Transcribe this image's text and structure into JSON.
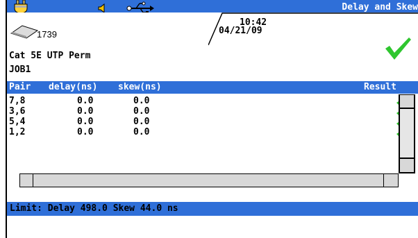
{
  "header": {
    "screen_title": "Delay and Skew",
    "count": "1739",
    "time": "10:42",
    "date": "04/21/09",
    "cable_type": "Cat 5E UTP Perm",
    "job": "JOB1",
    "overall_result_icon": "pass-checkmark-icon"
  },
  "status_icons": [
    "plug-icon",
    "speaker-icon",
    "usb-icon",
    "disk-icon"
  ],
  "columns": {
    "pair": "Pair",
    "delay": "delay(ns)",
    "skew": "skew(ns)",
    "result": "Result"
  },
  "rows": [
    {
      "pair": "7,8",
      "delay": "0.0",
      "skew": "0.0",
      "result": "pass"
    },
    {
      "pair": "3,6",
      "delay": "0.0",
      "skew": "0.0",
      "result": "pass"
    },
    {
      "pair": "5,4",
      "delay": "0.0",
      "skew": "0.0",
      "result": "pass"
    },
    {
      "pair": "1,2",
      "delay": "0.0",
      "skew": "0.0",
      "result": "pass"
    }
  ],
  "limit": "Limit: Delay 498.0 Skew 44.0 ns",
  "colors": {
    "bar_blue": "#2f6fd8",
    "pass_green": "#2fc62f"
  }
}
